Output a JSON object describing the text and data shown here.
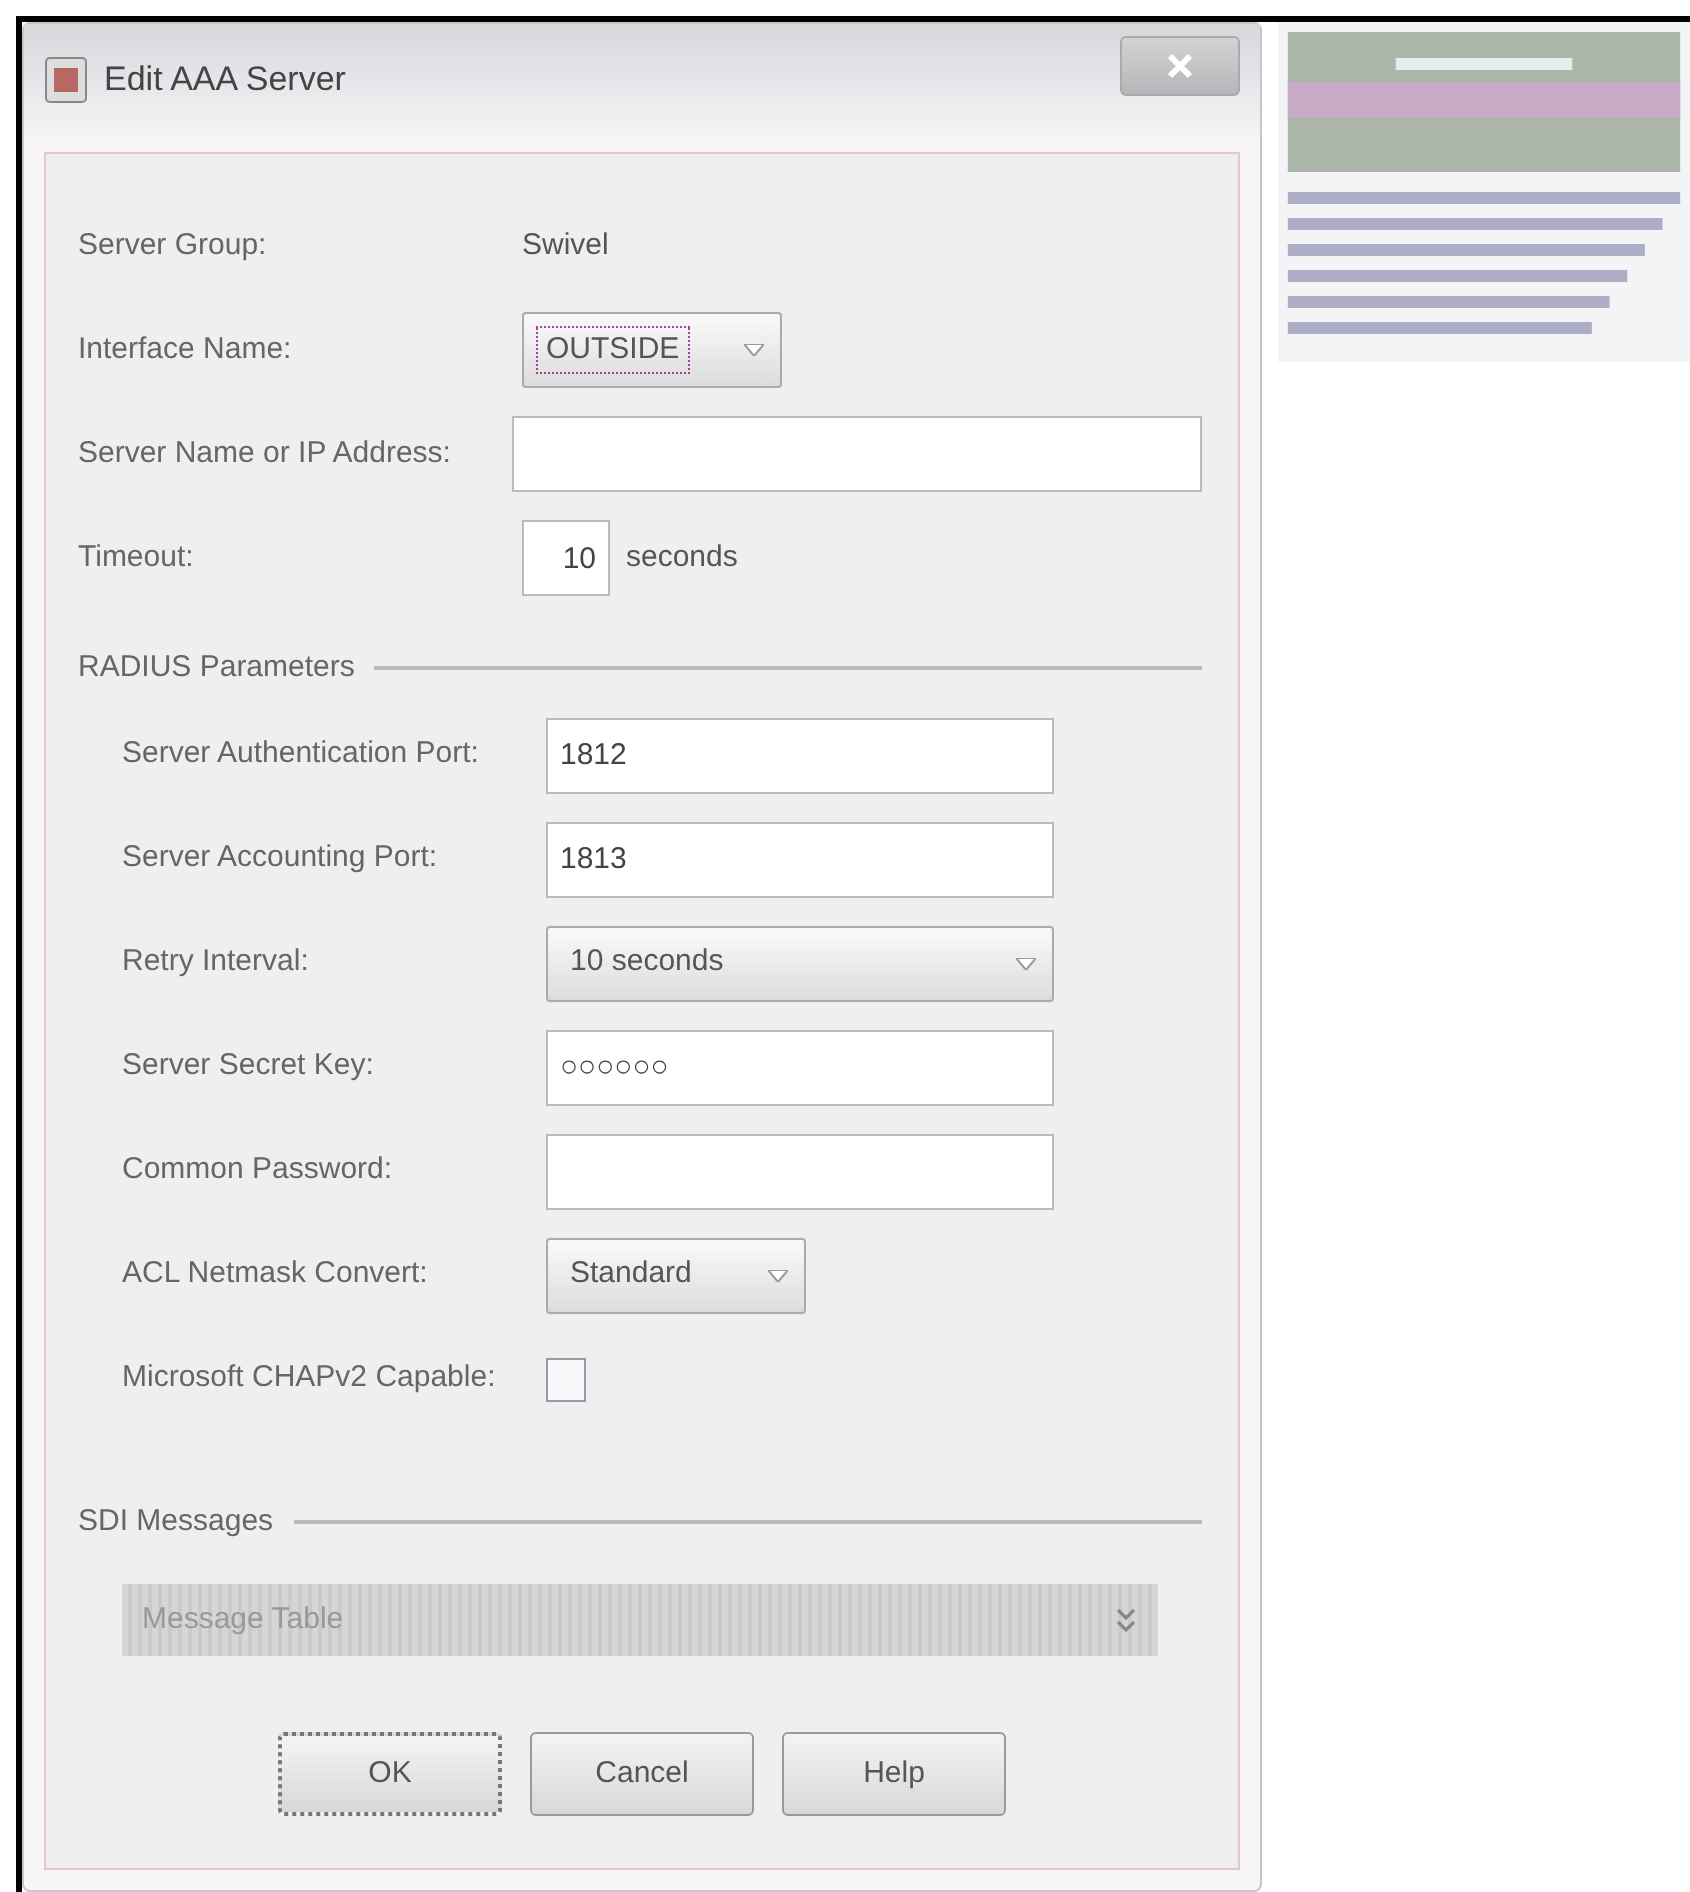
{
  "window": {
    "title": "Edit AAA Server"
  },
  "fields": [
    {
      "kind": "static",
      "label": "Server Group:",
      "value": "Swivel"
    },
    {
      "kind": "select",
      "label": "Interface Name:",
      "value": "OUTSIDE",
      "focused": true
    },
    {
      "kind": "text",
      "label": "Server Name or IP Address:"
    },
    {
      "kind": "number",
      "label": "Timeout:",
      "value": "10",
      "unit": "seconds"
    }
  ],
  "radius": {
    "title": "RADIUS Parameters",
    "fields": [
      {
        "kind": "text",
        "label": "Server Authentication Port:",
        "value": "1812"
      },
      {
        "kind": "text",
        "label": "Server Accounting Port:",
        "value": "1813"
      },
      {
        "kind": "select",
        "label": "Retry Interval:",
        "value": "10 seconds",
        "focused": false
      },
      {
        "kind": "text",
        "label": "Server Secret Key:",
        "value": "○○○○○○"
      },
      {
        "kind": "text",
        "label": "Common Password:"
      },
      {
        "kind": "select",
        "label": "ACL Netmask Convert:",
        "value": "Standard",
        "focused": false
      },
      {
        "kind": "checkbox",
        "label": "Microsoft CHAPv2 Capable:",
        "checked": false
      }
    ]
  },
  "sdi": {
    "title": "SDI Messages",
    "panel": {
      "label": "Message Table",
      "disabled": true
    }
  },
  "buttons": [
    {
      "label": "OK",
      "focused": true
    },
    {
      "label": "Cancel",
      "focused": false
    },
    {
      "label": "Help",
      "focused": false
    }
  ]
}
